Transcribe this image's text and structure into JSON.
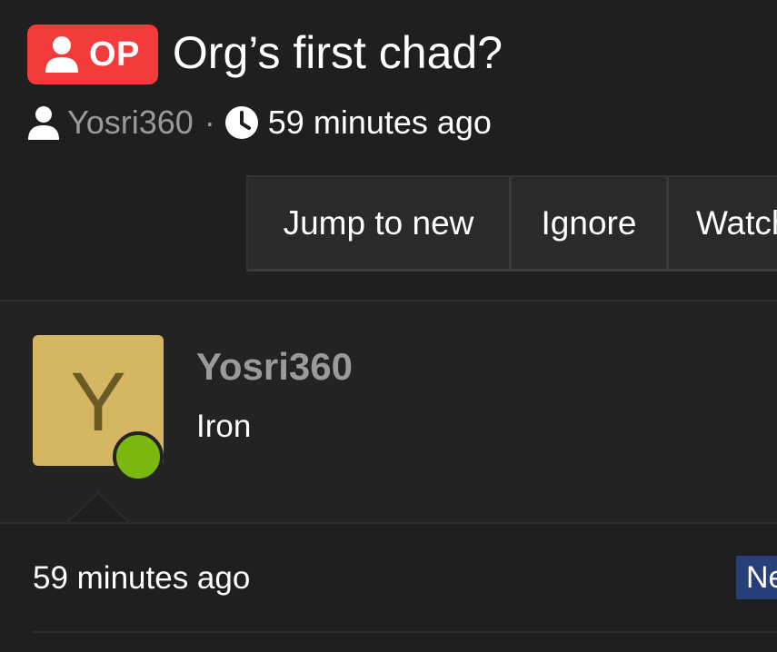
{
  "thread": {
    "op_badge_label": "OP",
    "title": "Org’s first chad?",
    "author": "Yosri360",
    "meta_separator": "·",
    "time": "59 minutes ago"
  },
  "actions": {
    "jump_to_new": "Jump to new",
    "ignore": "Ignore",
    "watch": "Watch"
  },
  "post": {
    "avatar_letter": "Y",
    "username": "Yosri360",
    "user_title": "Iron",
    "time": "59 minutes ago",
    "new_badge": "New"
  },
  "icons": {
    "op_user": "user-icon",
    "meta_user": "user-icon",
    "clock": "clock-icon"
  },
  "colors": {
    "background": "#1f1f1f",
    "op_badge": "#f43b3b",
    "avatar_bg": "#d5b763",
    "avatar_letter": "#6b5a24",
    "online": "#7ab80f",
    "new_badge": "#27407a",
    "muted_text": "#9a9a9a"
  }
}
